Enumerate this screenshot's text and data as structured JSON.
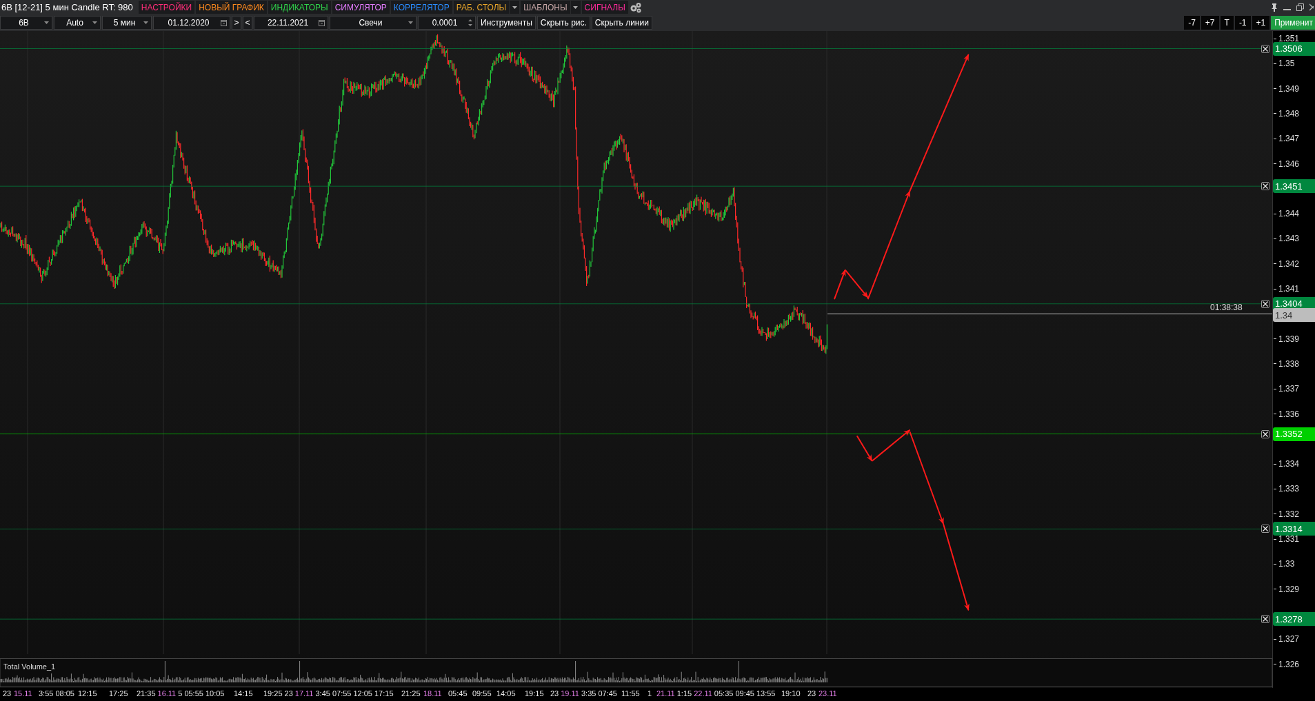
{
  "window": {
    "title": "6B [12-21] 5 мин Candle RT: 980"
  },
  "menu": [
    {
      "label": "НАСТРОЙКИ",
      "color": "#ff2d78",
      "dropdown": false
    },
    {
      "label": "НОВЫЙ ГРАФИК",
      "color": "#ff8a1e",
      "dropdown": false
    },
    {
      "label": "ИНДИКАТОРЫ",
      "color": "#2fd24a",
      "dropdown": false
    },
    {
      "label": "СИМУЛЯТОР",
      "color": "#e47cff",
      "dropdown": false
    },
    {
      "label": "КОРРЕЛЯТОР",
      "color": "#2a8cff",
      "dropdown": false
    },
    {
      "label": "РАБ. СТОЛЫ",
      "color": "#e8a52a",
      "dropdown": true
    },
    {
      "label": "ШАБЛОНЫ",
      "color": "#c9a9a9",
      "dropdown": true
    },
    {
      "label": "СИГНАЛЫ",
      "color": "#ff2a9a",
      "dropdown": false
    }
  ],
  "toolbar": [
    {
      "kind": "select",
      "value": "6B"
    },
    {
      "kind": "select",
      "value": "Auto"
    },
    {
      "kind": "select",
      "value": "5 мин"
    },
    {
      "kind": "date",
      "value": "01.12.2020"
    },
    {
      "kind": "button",
      "label": ">"
    },
    {
      "kind": "button",
      "label": "<"
    },
    {
      "kind": "date",
      "value": "22.11.2021"
    },
    {
      "kind": "select",
      "value": "Свечи"
    },
    {
      "kind": "spinner",
      "value": "0.0001"
    },
    {
      "kind": "button",
      "label": "Инструменты"
    },
    {
      "kind": "button",
      "label": "Скрыть рис."
    },
    {
      "kind": "button",
      "label": "Скрыть линии"
    }
  ],
  "shift_buttons": [
    "-7",
    "+7",
    "T",
    "-1",
    "+1"
  ],
  "apply_button": "Применит",
  "chart": {
    "price_ticks": [
      "1.351",
      "1.35",
      "1.349",
      "1.348",
      "1.347",
      "1.346",
      "1.344",
      "1.343",
      "1.342",
      "1.341",
      "1.339",
      "1.338",
      "1.337",
      "1.336",
      "1.334",
      "1.333",
      "1.332",
      "1.331",
      "1.33",
      "1.329",
      "1.327",
      "1.326"
    ],
    "levels": [
      {
        "price": "1.3506",
        "color": "#00873e"
      },
      {
        "price": "1.3451",
        "color": "#00873e"
      },
      {
        "price": "1.3404",
        "color": "#00873e"
      },
      {
        "price": "1.3352",
        "color": "#00d000"
      },
      {
        "price": "1.3314",
        "color": "#00873e"
      },
      {
        "price": "1.3278",
        "color": "#00873e"
      }
    ],
    "current_price": "1.34",
    "countdown": "01:38:38",
    "volume_title": "Total Volume_1",
    "time_labels": [
      {
        "text": "23",
        "kind": "time"
      },
      {
        "text": "15.11",
        "kind": "date"
      },
      {
        "text": "3:55",
        "kind": "time"
      },
      {
        "text": "08:05",
        "kind": "time"
      },
      {
        "text": "12:15",
        "kind": "time"
      },
      {
        "text": "17:25",
        "kind": "time"
      },
      {
        "text": "21:35",
        "kind": "time"
      },
      {
        "text": "16.11",
        "kind": "date"
      },
      {
        "text": "5",
        "kind": "time"
      },
      {
        "text": "05:55",
        "kind": "time"
      },
      {
        "text": "10:05",
        "kind": "time"
      },
      {
        "text": "14:15",
        "kind": "time"
      },
      {
        "text": "19:25",
        "kind": "time"
      },
      {
        "text": "23",
        "kind": "time"
      },
      {
        "text": "17.11",
        "kind": "date"
      },
      {
        "text": "3:45",
        "kind": "time"
      },
      {
        "text": "07:55",
        "kind": "time"
      },
      {
        "text": "12:05",
        "kind": "time"
      },
      {
        "text": "17:15",
        "kind": "time"
      },
      {
        "text": "21:25",
        "kind": "time"
      },
      {
        "text": "18.11",
        "kind": "date"
      },
      {
        "text": "05:45",
        "kind": "time"
      },
      {
        "text": "09:55",
        "kind": "time"
      },
      {
        "text": "14:05",
        "kind": "time"
      },
      {
        "text": "19:15",
        "kind": "time"
      },
      {
        "text": "23",
        "kind": "time"
      },
      {
        "text": "19.11",
        "kind": "date"
      },
      {
        "text": "3:35",
        "kind": "time"
      },
      {
        "text": "07:45",
        "kind": "time"
      },
      {
        "text": "11:55",
        "kind": "time"
      },
      {
        "text": "1",
        "kind": "time"
      },
      {
        "text": "21.11",
        "kind": "date"
      },
      {
        "text": "1:15",
        "kind": "time"
      },
      {
        "text": "22.11",
        "kind": "date"
      },
      {
        "text": "05:35",
        "kind": "time"
      },
      {
        "text": "09:45",
        "kind": "time"
      },
      {
        "text": "13:55",
        "kind": "time"
      },
      {
        "text": "19:10",
        "kind": "time"
      },
      {
        "text": "23",
        "kind": "time"
      },
      {
        "text": "23.11",
        "kind": "date"
      }
    ]
  }
}
